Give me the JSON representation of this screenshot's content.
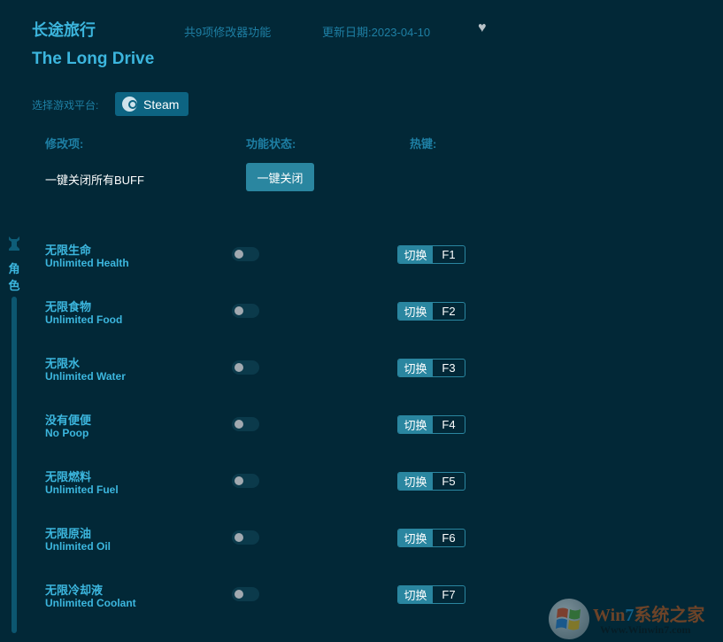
{
  "header": {
    "title_cn": "长途旅行",
    "title_en": "The Long Drive",
    "feature_count": "共9项修改器功能",
    "update_date": "更新日期:2023-04-10",
    "favorite_icon": "heart-icon"
  },
  "platform": {
    "label": "选择游戏平台:",
    "selected": "Steam",
    "icon": "steam-icon"
  },
  "columns": {
    "item": "修改项:",
    "status": "功能状态:",
    "hotkey": "热键:"
  },
  "global": {
    "label": "一键关闭所有BUFF",
    "button": "一键关闭"
  },
  "category": {
    "label": "角色",
    "icon": "character-icon"
  },
  "cheats": [
    {
      "name_cn": "无限生命",
      "name_en": "Unlimited Health",
      "enabled": false,
      "action": "切换",
      "key": "F1"
    },
    {
      "name_cn": "无限食物",
      "name_en": "Unlimited Food",
      "enabled": false,
      "action": "切换",
      "key": "F2"
    },
    {
      "name_cn": "无限水",
      "name_en": "Unlimited Water",
      "enabled": false,
      "action": "切换",
      "key": "F3"
    },
    {
      "name_cn": "没有便便",
      "name_en": "No Poop",
      "enabled": false,
      "action": "切换",
      "key": "F4"
    },
    {
      "name_cn": "无限燃料",
      "name_en": "Unlimited Fuel",
      "enabled": false,
      "action": "切换",
      "key": "F5"
    },
    {
      "name_cn": "无限原油",
      "name_en": "Unlimited Oil",
      "enabled": false,
      "action": "切换",
      "key": "F6"
    },
    {
      "name_cn": "无限冷却液",
      "name_en": "Unlimited Coolant",
      "enabled": false,
      "action": "切换",
      "key": "F7"
    }
  ],
  "watermark": {
    "brand_w": "Win",
    "brand_7": "7",
    "brand_cn": "系统之家",
    "url": "Www.Winwin7.com"
  }
}
